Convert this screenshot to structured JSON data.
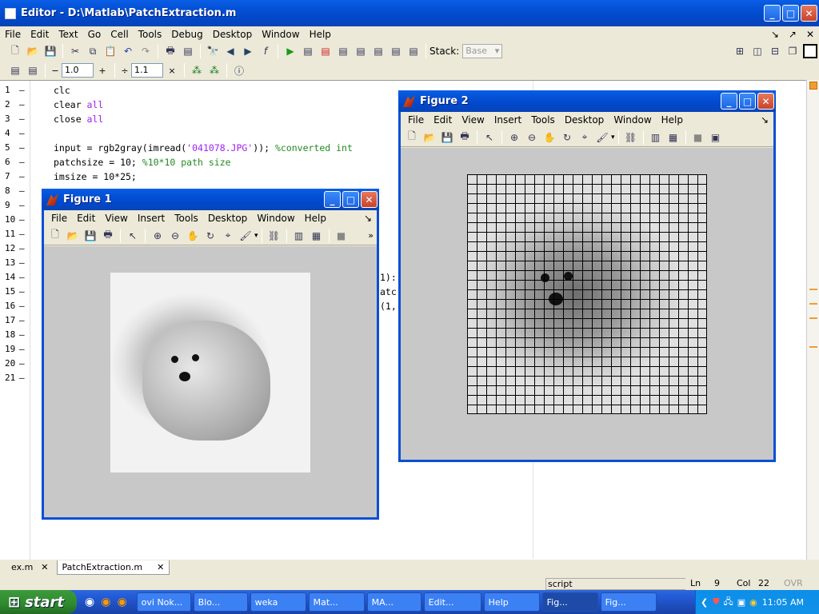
{
  "editor": {
    "title": "Editor - D:\\Matlab\\PatchExtraction.m",
    "menu": [
      "File",
      "Edit",
      "Text",
      "Go",
      "Cell",
      "Tools",
      "Debug",
      "Desktop",
      "Window",
      "Help"
    ],
    "stack_label": "Stack:",
    "stack_value": "Base",
    "cell_minus_value": "1.0",
    "cell_div_value": "1.1",
    "line_numbers": [
      "1",
      "2",
      "3",
      "4",
      "5",
      "6",
      "7",
      "8",
      "9",
      "10",
      "11",
      "12",
      "13",
      "14",
      "15",
      "16",
      "17",
      "18",
      "19",
      "20",
      "21"
    ],
    "code": {
      "l1": "clc",
      "l2a": "clear ",
      "l2b": "all",
      "l3a": "close ",
      "l3b": "all",
      "l5a": "input = rgb2gray(imread(",
      "l5b": "'041078.JPG'",
      "l5c": ")); ",
      "l5d": "%converted int",
      "l6a": "patchsize = 10; ",
      "l6b": "%10*10 path size",
      "l7": "imsize = 10*25;",
      "l14": "1):",
      "l15": "atc",
      "l16": "(1,"
    },
    "tabs": [
      "ex.m",
      "PatchExtraction.m"
    ],
    "status": {
      "mode": "script",
      "ln_label": "Ln",
      "ln": "9",
      "col_label": "Col",
      "col": "22",
      "ovr": "OVR"
    }
  },
  "figure1": {
    "title": "Figure 1",
    "menu": [
      "File",
      "Edit",
      "View",
      "Insert",
      "Tools",
      "Desktop",
      "Window",
      "Help"
    ]
  },
  "figure2": {
    "title": "Figure 2",
    "menu": [
      "File",
      "Edit",
      "View",
      "Insert",
      "Tools",
      "Desktop",
      "Window",
      "Help"
    ]
  },
  "taskbar": {
    "start": "start",
    "tasks": [
      "ovi Nok...",
      "Blo...",
      "weka",
      "Mat...",
      "MA...",
      "Edit...",
      "Help",
      "Fig...",
      "Fig..."
    ],
    "clock": "11:05 AM"
  }
}
